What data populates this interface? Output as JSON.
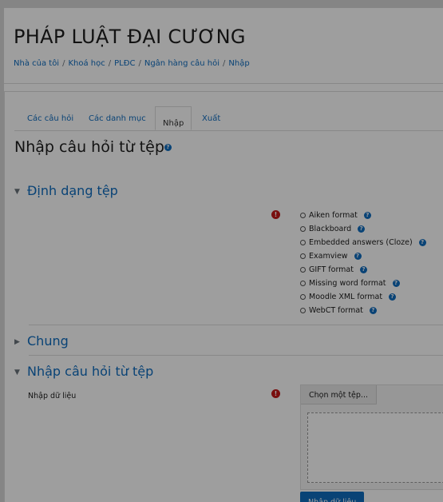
{
  "course": {
    "title": "PHÁP LUẬT ĐẠI CƯƠNG"
  },
  "breadcrumb": [
    "Nhà của tôi",
    "Khoá học",
    "PLĐC",
    "Ngân hàng câu hỏi",
    "Nhập"
  ],
  "tabs": [
    {
      "label": "Các câu hỏi",
      "active": false
    },
    {
      "label": "Các danh mục",
      "active": false
    },
    {
      "label": "Nhập",
      "active": true
    },
    {
      "label": "Xuất",
      "active": false
    }
  ],
  "page": {
    "heading": "Nhập câu hỏi từ tệp"
  },
  "sections": {
    "format": {
      "title": "Định dạng tệp",
      "options": [
        "Aiken format",
        "Blackboard",
        "Embedded answers (Cloze)",
        "Examview",
        "GIFT format",
        "Missing word format",
        "Moodle XML format",
        "WebCT format"
      ]
    },
    "general": {
      "title": "Chung"
    },
    "import": {
      "title": "Nhập câu hỏi từ tệp",
      "field_label": "Nhập dữ liệu",
      "choose_file_label": "Chọn một tệp...",
      "submit_label": "Nhập dữ liệu"
    }
  },
  "icons": {
    "help": "question-circle-icon",
    "required": "exclamation-circle-icon",
    "expanded": "caret-down-icon",
    "collapsed": "caret-right-icon"
  },
  "colors": {
    "link": "#0f6cbf",
    "required": "#c31818",
    "overlay": "rgba(0,0,0,0.38)"
  }
}
